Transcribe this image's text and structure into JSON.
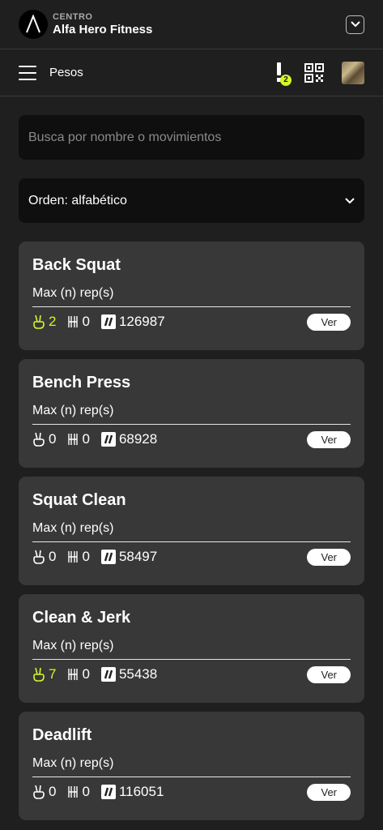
{
  "header": {
    "center_label": "CENTRO",
    "center_name": "Alfa Hero Fitness"
  },
  "nav": {
    "title": "Pesos",
    "notification_count": "2"
  },
  "search": {
    "placeholder": "Busca por nombre o movimientos",
    "value": ""
  },
  "sort": {
    "label": "Orden: alfabético"
  },
  "colors": {
    "accent": "#d6f52a",
    "background": "#1f1f1f",
    "card": "#383838"
  },
  "workouts": [
    {
      "name": "Back Squat",
      "subtitle": "Max (n) rep(s)",
      "peace": "2",
      "bar": "0",
      "brand": "126987",
      "button": "Ver",
      "peace_highlight": true
    },
    {
      "name": "Bench Press",
      "subtitle": "Max (n) rep(s)",
      "peace": "0",
      "bar": "0",
      "brand": "68928",
      "button": "Ver",
      "peace_highlight": false
    },
    {
      "name": "Squat Clean",
      "subtitle": "Max (n) rep(s)",
      "peace": "0",
      "bar": "0",
      "brand": "58497",
      "button": "Ver",
      "peace_highlight": false
    },
    {
      "name": "Clean & Jerk",
      "subtitle": "Max (n) rep(s)",
      "peace": "7",
      "bar": "0",
      "brand": "55438",
      "button": "Ver",
      "peace_highlight": true
    },
    {
      "name": "Deadlift",
      "subtitle": "Max (n) rep(s)",
      "peace": "0",
      "bar": "0",
      "brand": "116051",
      "button": "Ver",
      "peace_highlight": false
    }
  ]
}
